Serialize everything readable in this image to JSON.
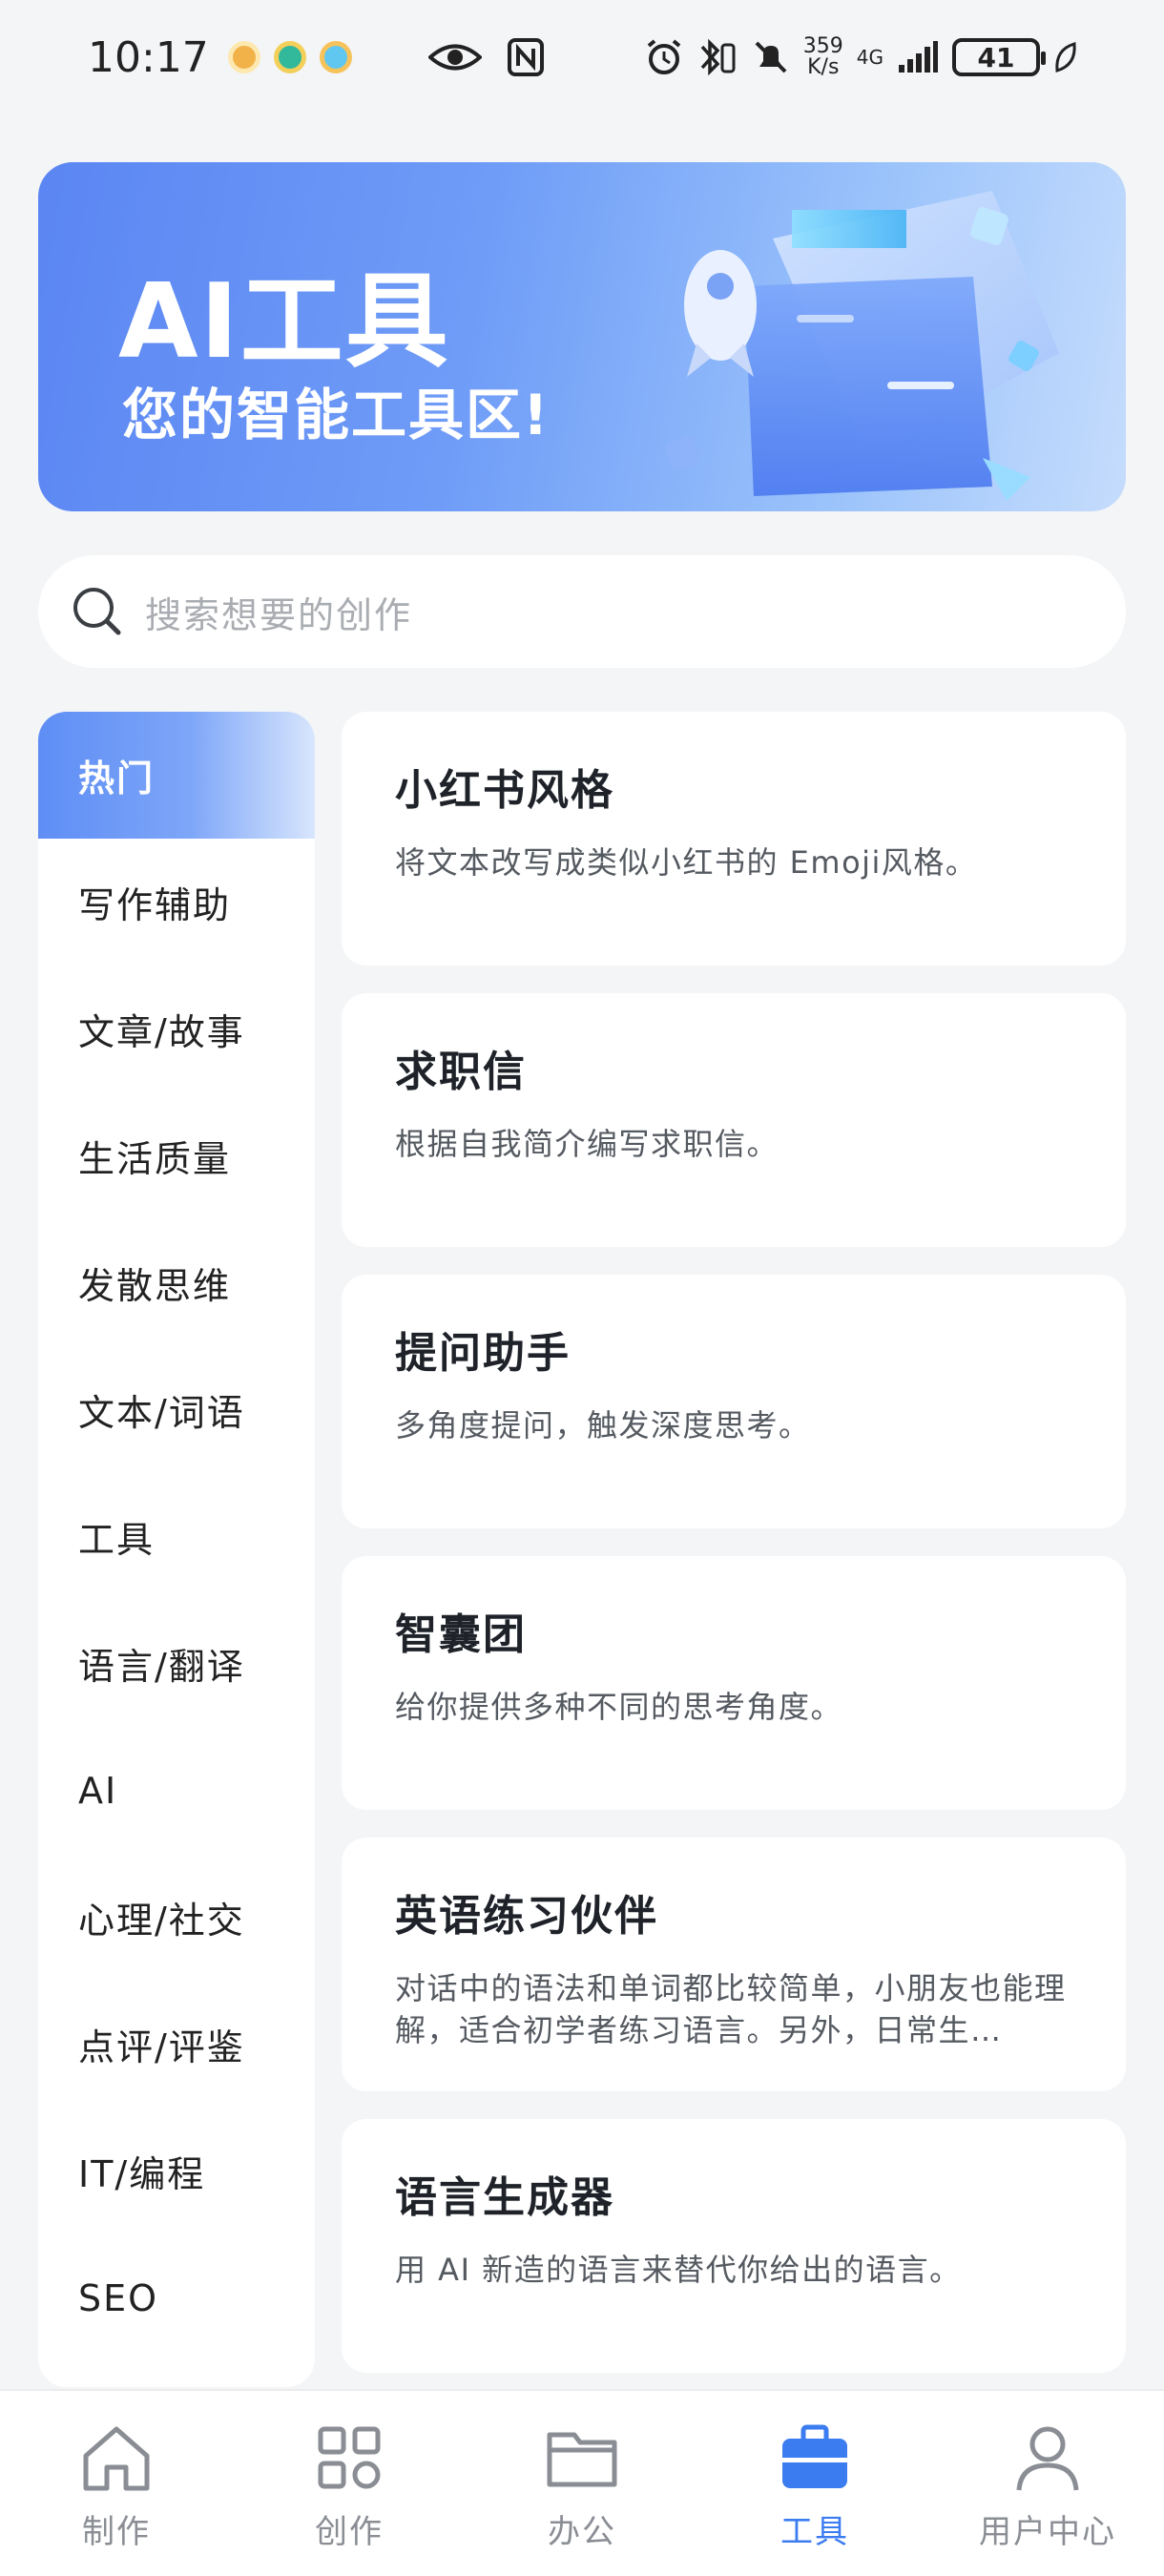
{
  "status_bar": {
    "time": "10:17",
    "net_speed_value": "359",
    "net_speed_unit": "K/s",
    "network": "4G",
    "battery": "41"
  },
  "banner": {
    "title": "AI工具",
    "subtitle": "您的智能工具区!"
  },
  "search": {
    "placeholder": "搜索想要的创作"
  },
  "sidebar": {
    "items": [
      {
        "label": "热门",
        "active": true
      },
      {
        "label": "写作辅助"
      },
      {
        "label": "文章/故事"
      },
      {
        "label": "生活质量"
      },
      {
        "label": "发散思维"
      },
      {
        "label": "文本/词语"
      },
      {
        "label": "工具"
      },
      {
        "label": "语言/翻译"
      },
      {
        "label": "AI"
      },
      {
        "label": "心理/社交"
      },
      {
        "label": "点评/评鉴"
      },
      {
        "label": "IT/编程"
      },
      {
        "label": "SEO"
      }
    ]
  },
  "cards": [
    {
      "title": "小红书风格",
      "desc": "将文本改写成类似小红书的 Emoji风格。"
    },
    {
      "title": "求职信",
      "desc": "根据自我简介编写求职信。"
    },
    {
      "title": "提问助手",
      "desc": "多角度提问，触发深度思考。"
    },
    {
      "title": "智囊团",
      "desc": "给你提供多种不同的思考角度。"
    },
    {
      "title": "英语练习伙伴",
      "desc": "对话中的语法和单词都比较简单，小朋友也能理解，适合初学者练习语言。另外，日常生…"
    },
    {
      "title": "语言生成器",
      "desc": "用 AI 新造的语言来替代你给出的语言。"
    }
  ],
  "bottom_nav": {
    "items": [
      {
        "label": "制作",
        "icon": "home-icon"
      },
      {
        "label": "创作",
        "icon": "grid-icon"
      },
      {
        "label": "办公",
        "icon": "folder-icon"
      },
      {
        "label": "工具",
        "icon": "toolbox-icon",
        "active": true
      },
      {
        "label": "用户中心",
        "icon": "user-icon"
      }
    ]
  },
  "colors": {
    "accent": "#3b7cf0",
    "banner_start": "#5b86f3",
    "page_bg": "#f4f5f7"
  }
}
